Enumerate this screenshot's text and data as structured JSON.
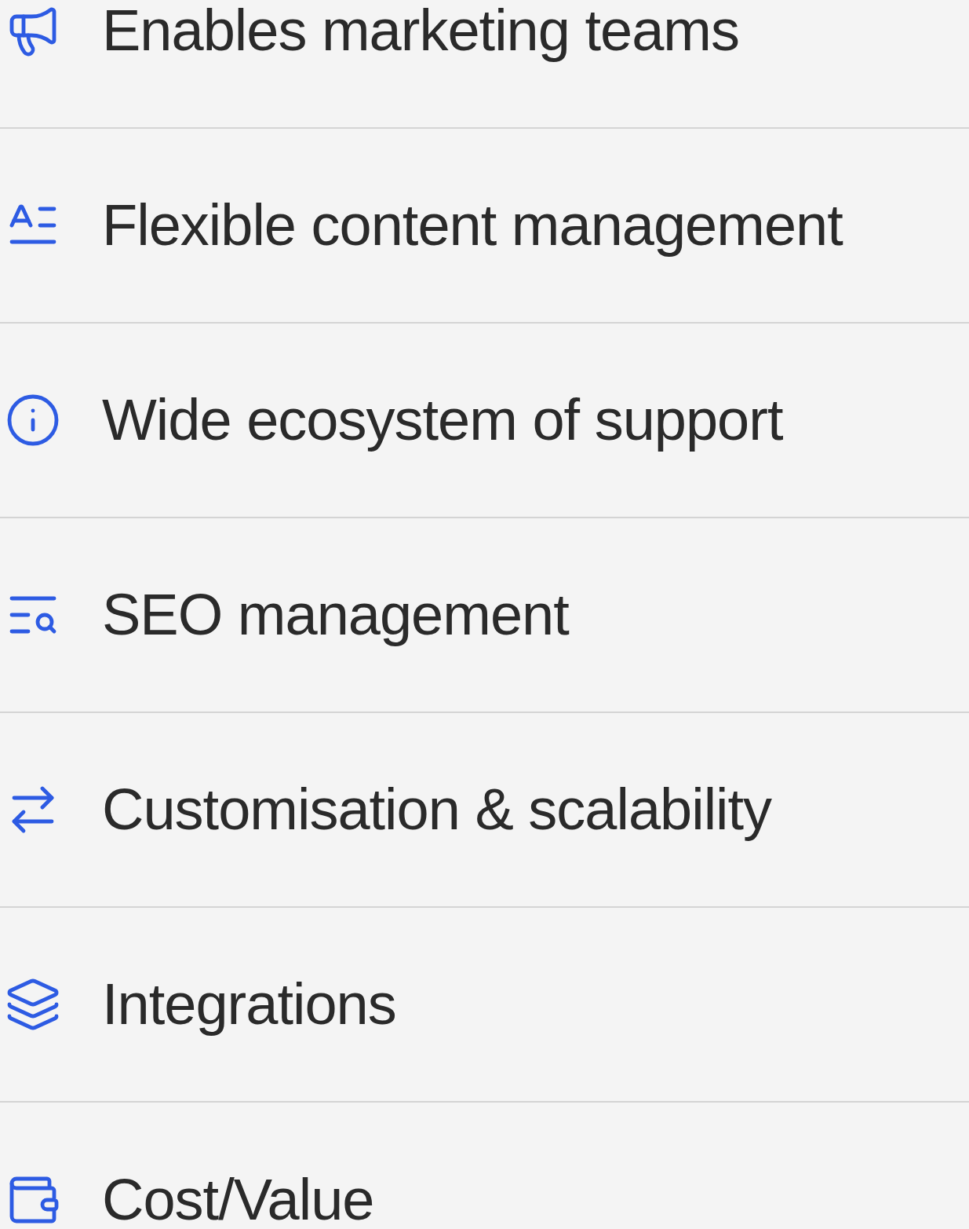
{
  "features": [
    {
      "label": "Enables marketing teams"
    },
    {
      "label": "Flexible content management"
    },
    {
      "label": "Wide ecosystem of support"
    },
    {
      "label": "SEO management"
    },
    {
      "label": "Customisation & scalability"
    },
    {
      "label": "Integrations"
    },
    {
      "label": "Cost/Value"
    }
  ]
}
